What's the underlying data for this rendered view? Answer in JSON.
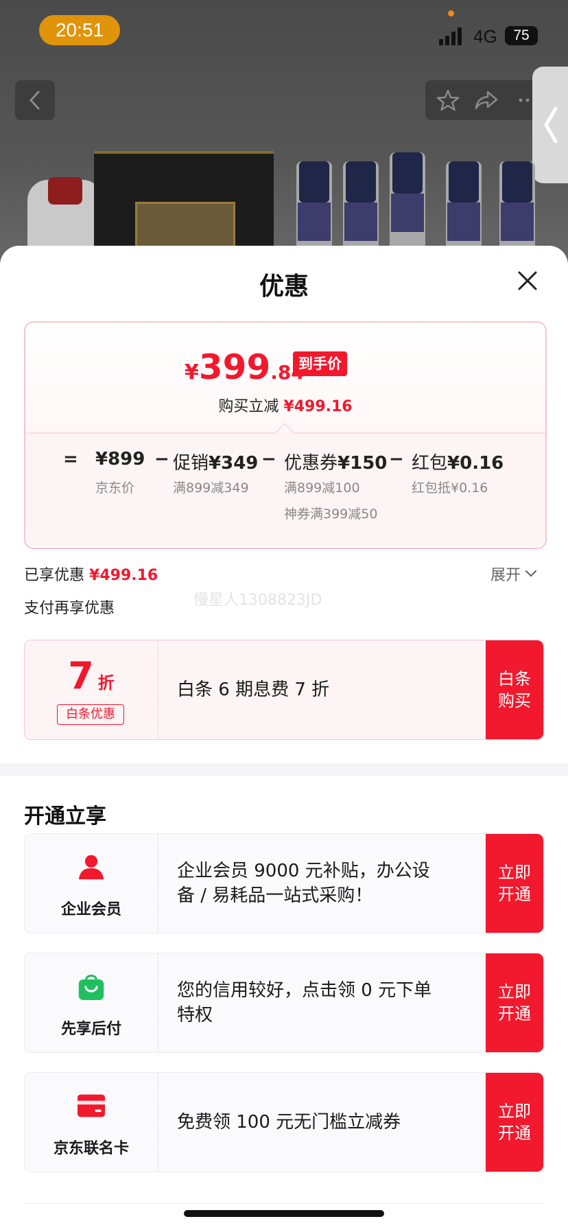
{
  "status_bar": {
    "time": "20:51",
    "network": "4G",
    "battery": "75"
  },
  "colors": {
    "accent": "#f2182d",
    "status_pill": "#e0940b",
    "green": "#1fbf5f"
  },
  "sheet": {
    "title": "优惠",
    "price_summary": {
      "final_price_symbol": "¥",
      "final_price_int": "399",
      "final_price_dec": ".84",
      "final_tag": "到手价",
      "reduce_label": "购买立减",
      "reduce_amount": "¥499.16",
      "breakdown": {
        "eq": "=",
        "jd_price": "¥899",
        "jd_price_label": "京东价",
        "minus1": "−",
        "promo_label": "促销",
        "promo_value": "¥349",
        "promo_sub": "满899减349",
        "minus2": "−",
        "coupon_label": "优惠券",
        "coupon_value": "¥150",
        "coupon_sub1": "满899减100",
        "coupon_sub2": "神券满399减50",
        "minus3": "−",
        "redpacket_label": "红包",
        "redpacket_value": "¥0.16",
        "redpacket_sub": "红包抵¥0.16"
      }
    },
    "enjoyed_label": "已享优惠",
    "enjoyed_value": "¥499.16",
    "expand_label": "展开",
    "watermark": "慢星人1308823JD",
    "pay_more_label": "支付再享优惠",
    "baitiao_offer": {
      "discount_num": "7",
      "discount_unit": "折",
      "tag": "白条优惠",
      "desc": "白条 6 期息费 7 折",
      "cta": "白条购买"
    },
    "open_section_title": "开通立享",
    "open_offers": [
      {
        "icon": "person-icon",
        "name": "企业会员",
        "desc": "企业会员 9000 元补贴，办公设备 / 易耗品一站式采购！",
        "cta": "立即开通"
      },
      {
        "icon": "shopping-bag-icon",
        "name": "先享后付",
        "desc": "您的信用较好，点击领 0 元下单特权",
        "cta": "立即开通"
      },
      {
        "icon": "card-icon",
        "name": "京东联名卡",
        "desc": "免费领 100 元无门槛立减券",
        "cta": "立即开通"
      }
    ]
  }
}
